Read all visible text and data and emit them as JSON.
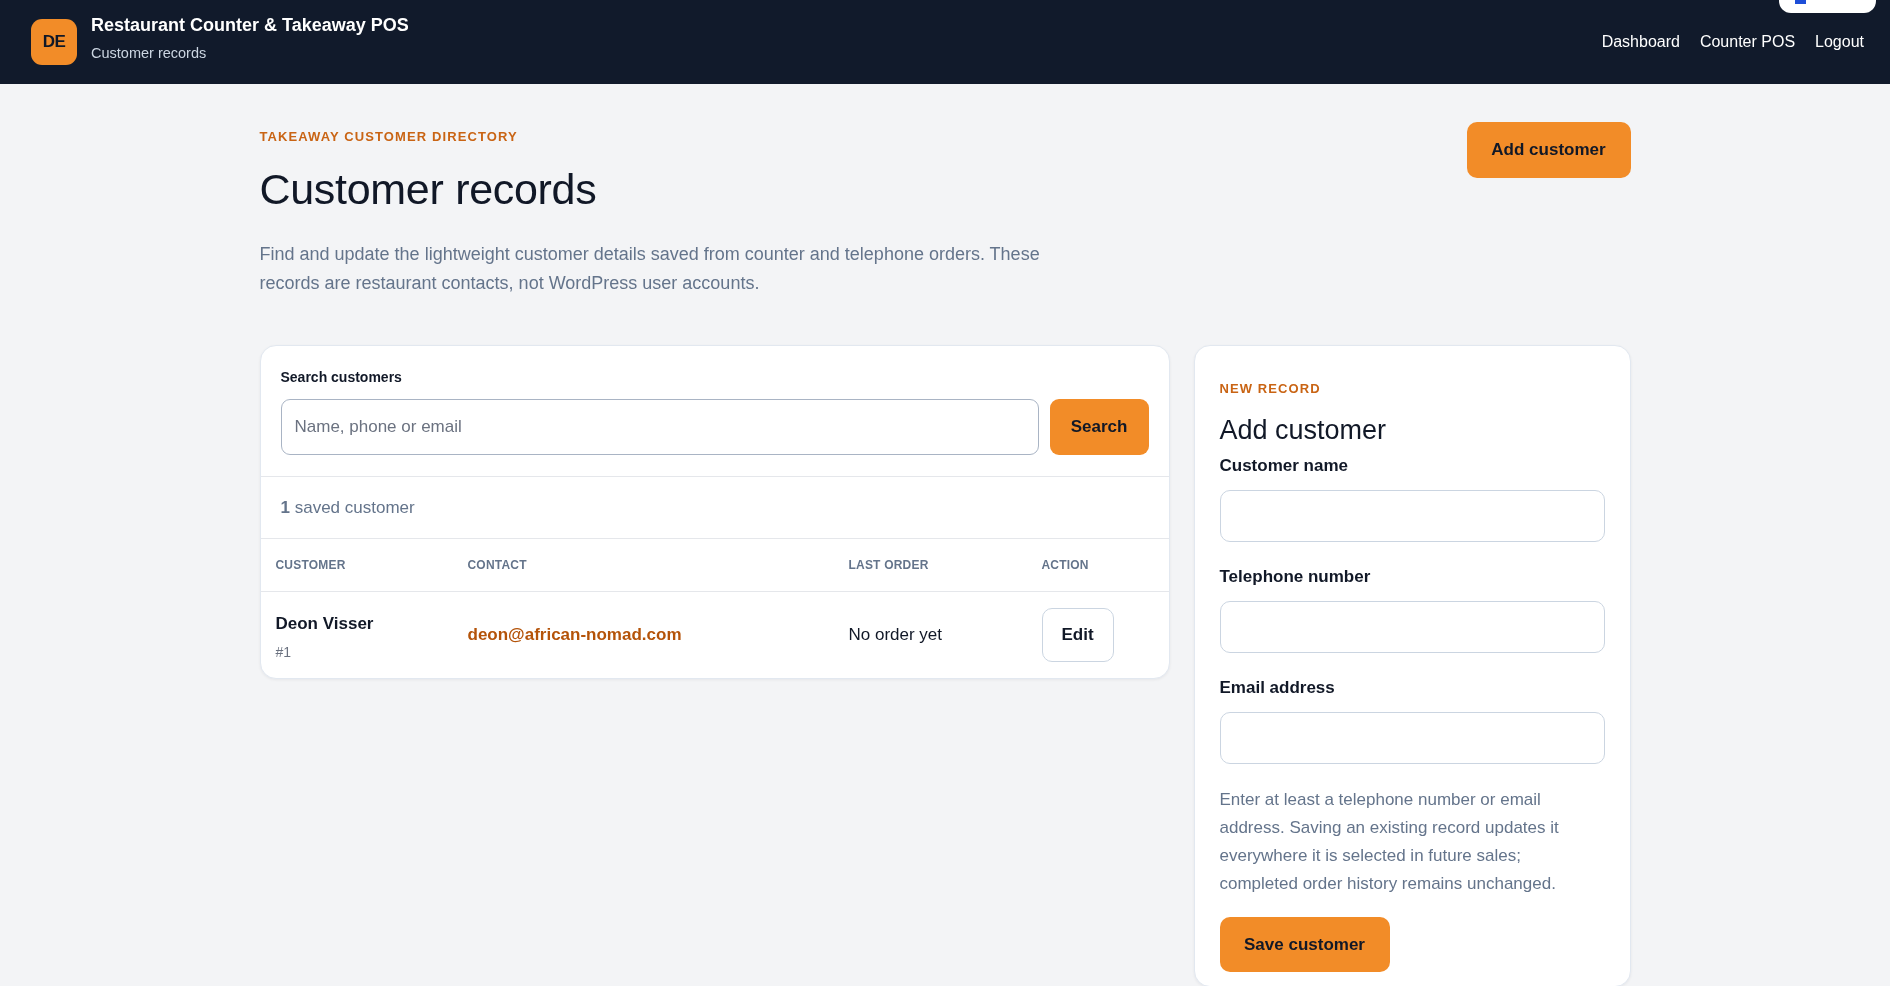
{
  "header": {
    "logo_initials": "DE",
    "title": "Restaurant Counter & Takeaway POS",
    "subtitle": "Customer records",
    "nav": [
      {
        "label": "Dashboard"
      },
      {
        "label": "Counter POS"
      },
      {
        "label": "Logout"
      }
    ]
  },
  "intro": {
    "eyebrow": "TAKEAWAY CUSTOMER DIRECTORY",
    "title": "Customer records",
    "description": "Find and update the lightweight customer details saved from counter and telephone orders. These records are restaurant contacts, not WordPress user accounts.",
    "add_button": "Add customer"
  },
  "search_card": {
    "label": "Search customers",
    "search_field": {
      "placeholder": "Name, phone or email"
    },
    "search_button": "Search",
    "count": "**1** saved customer",
    "table": {
      "columns": [
        "CUSTOMER",
        "CONTACT",
        "LAST ORDER",
        "ACTION"
      ],
      "rows": [
        {
          "name": "Deon Visser",
          "number": "#1",
          "contact": "deon@african-nomad.com",
          "last_order": "No order yet",
          "action": "Edit"
        }
      ]
    }
  },
  "form_card": {
    "eyebrow": "NEW RECORD",
    "title": "Add customer",
    "fields": [
      {
        "label": "Customer name"
      },
      {
        "label": "Telephone number"
      },
      {
        "label": "Email address"
      }
    ],
    "help": "Enter at least a telephone number or email address. Saving an existing record updates it everywhere it is selected in future sales; completed order history remains unchanged.",
    "submit_button": "Save customer"
  }
}
